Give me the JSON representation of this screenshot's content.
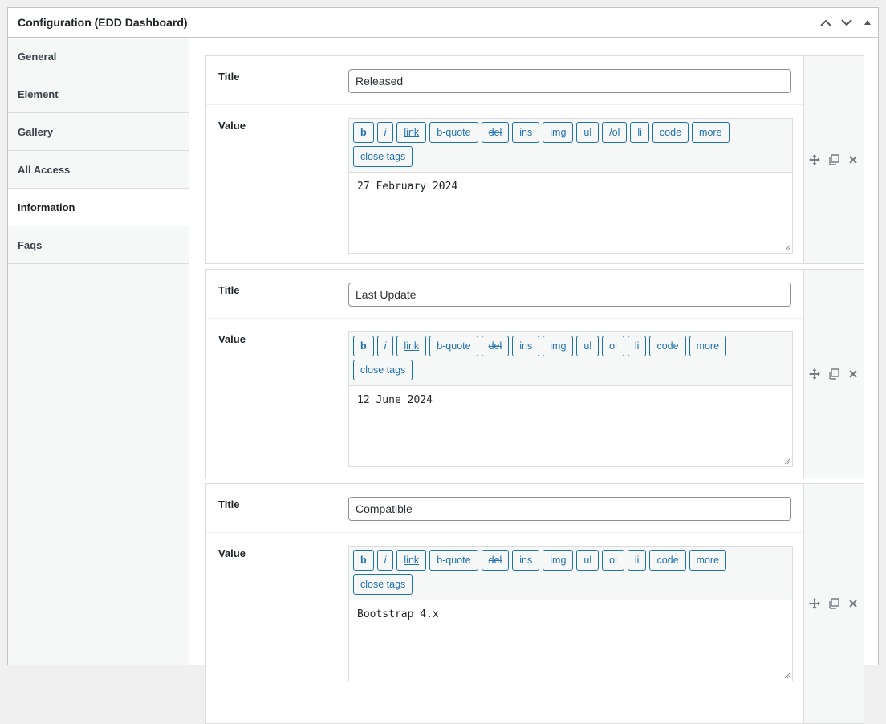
{
  "metabox": {
    "title": "Configuration (EDD Dashboard)",
    "controls": [
      "chevron-up-icon",
      "chevron-down-icon",
      "triangle-up-icon"
    ]
  },
  "tabs": [
    {
      "label": "General",
      "active": false
    },
    {
      "label": "Element",
      "active": false
    },
    {
      "label": "Gallery",
      "active": false
    },
    {
      "label": "All Access",
      "active": false
    },
    {
      "label": "Information",
      "active": true
    },
    {
      "label": "Faqs",
      "active": false
    }
  ],
  "labels": {
    "title": "Title",
    "value": "Value"
  },
  "toolbar": [
    "b",
    "i",
    "link",
    "b-quote",
    "del",
    "ins",
    "img",
    "ul",
    "ol",
    "li",
    "code",
    "more",
    "close tags"
  ],
  "rows": [
    {
      "title": "Released",
      "value": "27 February 2024",
      "toolbar": [
        "b",
        "i",
        "link",
        "b-quote",
        "del",
        "ins",
        "img",
        "ul",
        "/ol",
        "li",
        "code",
        "more",
        "close tags"
      ]
    },
    {
      "title": "Last Update",
      "value": "12 June 2024",
      "toolbar": [
        "b",
        "i",
        "link",
        "b-quote",
        "del",
        "ins",
        "img",
        "ul",
        "ol",
        "li",
        "code",
        "more",
        "close tags"
      ]
    },
    {
      "title": "Compatible",
      "value": "Bootstrap 4.x",
      "toolbar": [
        "b",
        "i",
        "link",
        "b-quote",
        "del",
        "ins",
        "img",
        "ul",
        "ol",
        "li",
        "code",
        "more",
        "close tags"
      ]
    }
  ],
  "row_actions": [
    "move-icon",
    "duplicate-icon",
    "close-icon"
  ]
}
